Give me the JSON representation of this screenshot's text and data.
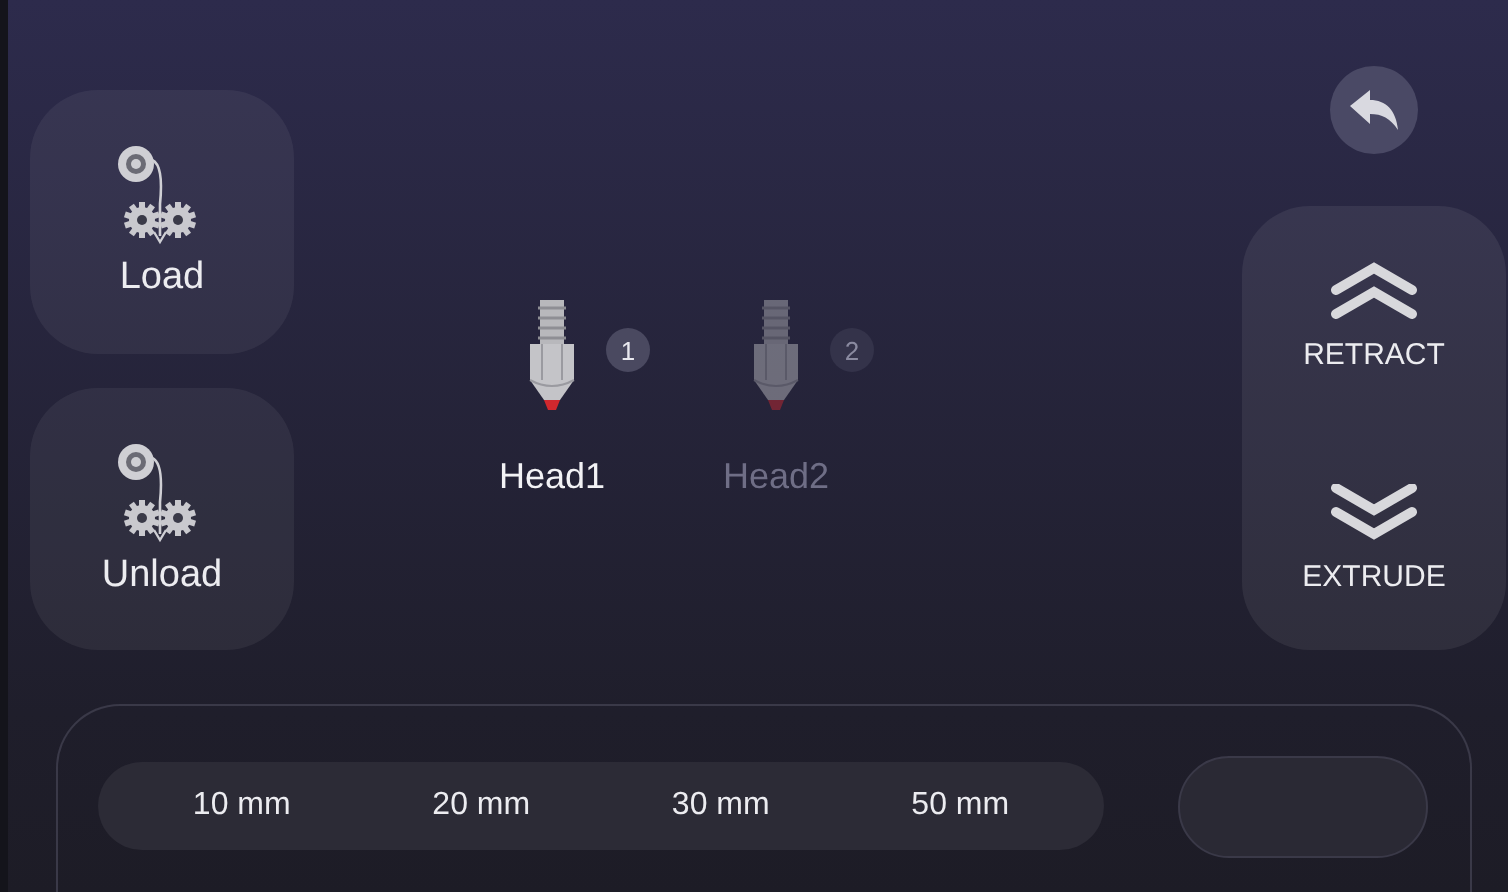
{
  "filament_buttons": [
    {
      "label": "Load",
      "kind": "load"
    },
    {
      "label": "Unload",
      "kind": "unload"
    }
  ],
  "heads": [
    {
      "label": "Head1",
      "number": "1",
      "selected": true
    },
    {
      "label": "Head2",
      "number": "2",
      "selected": false
    }
  ],
  "motion_buttons": [
    {
      "label": "RETRACT",
      "kind": "up"
    },
    {
      "label": "EXTRUDE",
      "kind": "down"
    }
  ],
  "distances": [
    "10 mm",
    "20 mm",
    "30 mm",
    "50 mm"
  ]
}
